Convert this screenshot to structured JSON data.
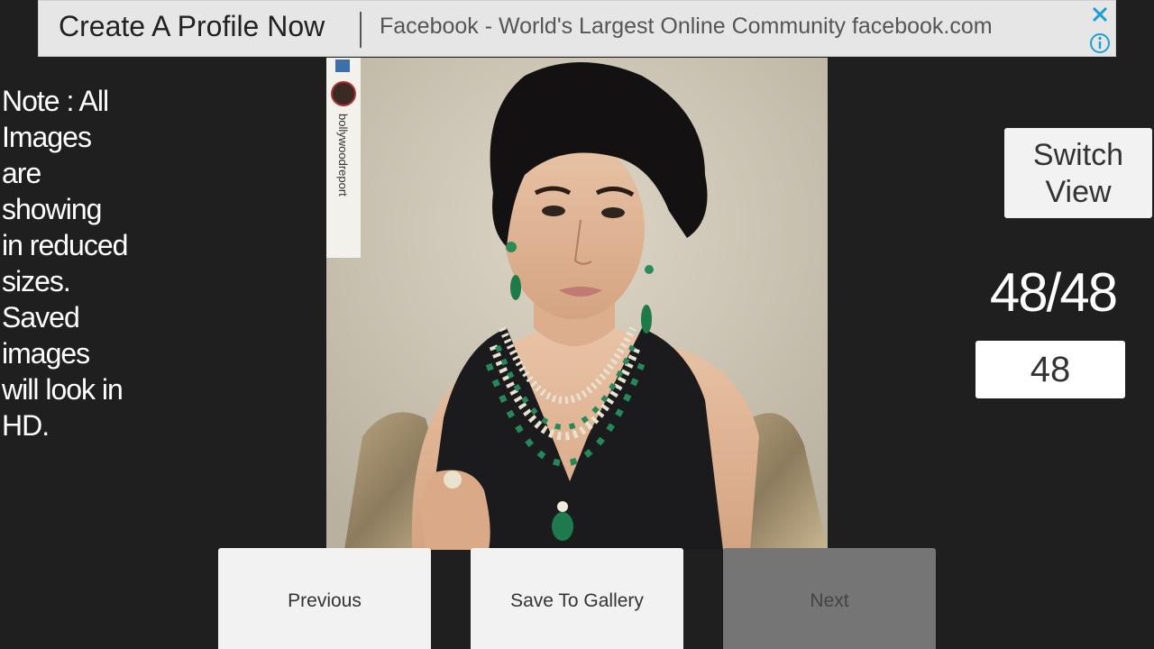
{
  "ad": {
    "headline": "Create A Profile Now",
    "description": "Facebook - World's Largest Online Community facebook.com",
    "accent_color": "#1a9fd6"
  },
  "note": {
    "text": "Note : All Images are showing in reduced sizes. Saved images will look in HD."
  },
  "photo": {
    "watermark": "bollywoodreport"
  },
  "controls": {
    "switch_view_label": "Switch View",
    "counter": "48/48",
    "page_input_value": "48"
  },
  "buttons": {
    "previous": "Previous",
    "save": "Save To Gallery",
    "next": "Next"
  }
}
